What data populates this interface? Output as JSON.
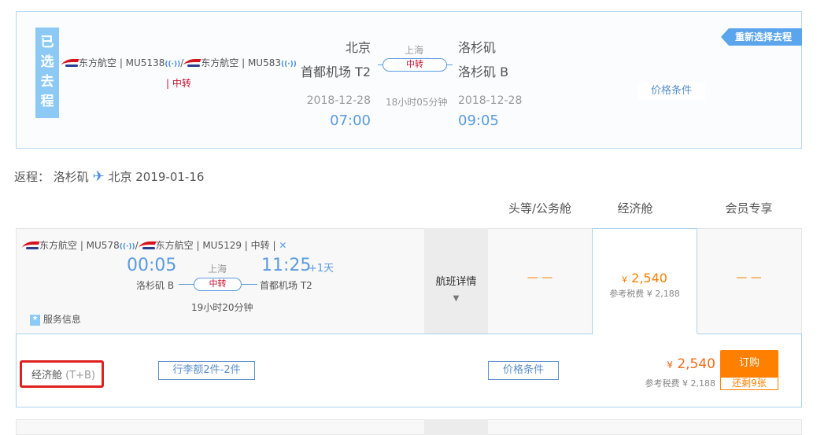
{
  "outbound": {
    "badge": "已选去程",
    "airline1": "东方航空 | MU5138",
    "sep": "/",
    "airline2": "东方航空 | MU583",
    "transfer_tag": "| 中转",
    "dep_city": "北京",
    "dep_airport": "首都机场 T2",
    "dep_date": "2018-12-28",
    "dep_time": "07:00",
    "via_city": "上海",
    "via_label": "中转",
    "duration": "18小时05分钟",
    "arr_city": "洛杉矶",
    "arr_airport": "洛杉矶 B",
    "arr_date": "2018-12-28",
    "arr_time": "09:05",
    "price_terms": "价格条件",
    "reselect": "重新选择去程"
  },
  "return": {
    "label": "返程：",
    "from": "洛杉矶",
    "to_date": "北京 2019-01-16"
  },
  "columns": [
    "头等/公务舱",
    "经济舱",
    "会员专享"
  ],
  "flight": {
    "airline1": "东方航空 | MU578",
    "sep": "/",
    "airline2": "东方航空 | MU5129 | 中转 |",
    "dep_time": "00:05",
    "dep_airport": "洛杉矶 B",
    "via_city": "上海",
    "via_label": "中转",
    "arr_time": "11:25",
    "day_offset": "+1天",
    "arr_airport": "首都机场 T2",
    "duration": "19小时20分钟",
    "service": "服务信息",
    "details": "航班详情",
    "first_price": "— —",
    "eco_price": "2,540",
    "currency": "¥",
    "eco_tax": "参考税费 ¥ 2,188",
    "member_price": "— —"
  },
  "cabin": {
    "name": "经济舱",
    "code": "(T+B)",
    "baggage": "行李额2件-2件",
    "price_terms": "价格条件",
    "currency": "¥",
    "price": "2,540",
    "tax": "参考税费 ¥  2,188",
    "buy": "订购",
    "remaining": "还剩9张"
  },
  "colors": {
    "accent": "#5b9be0",
    "orange": "#ff7f00",
    "red": "#c8102e"
  }
}
